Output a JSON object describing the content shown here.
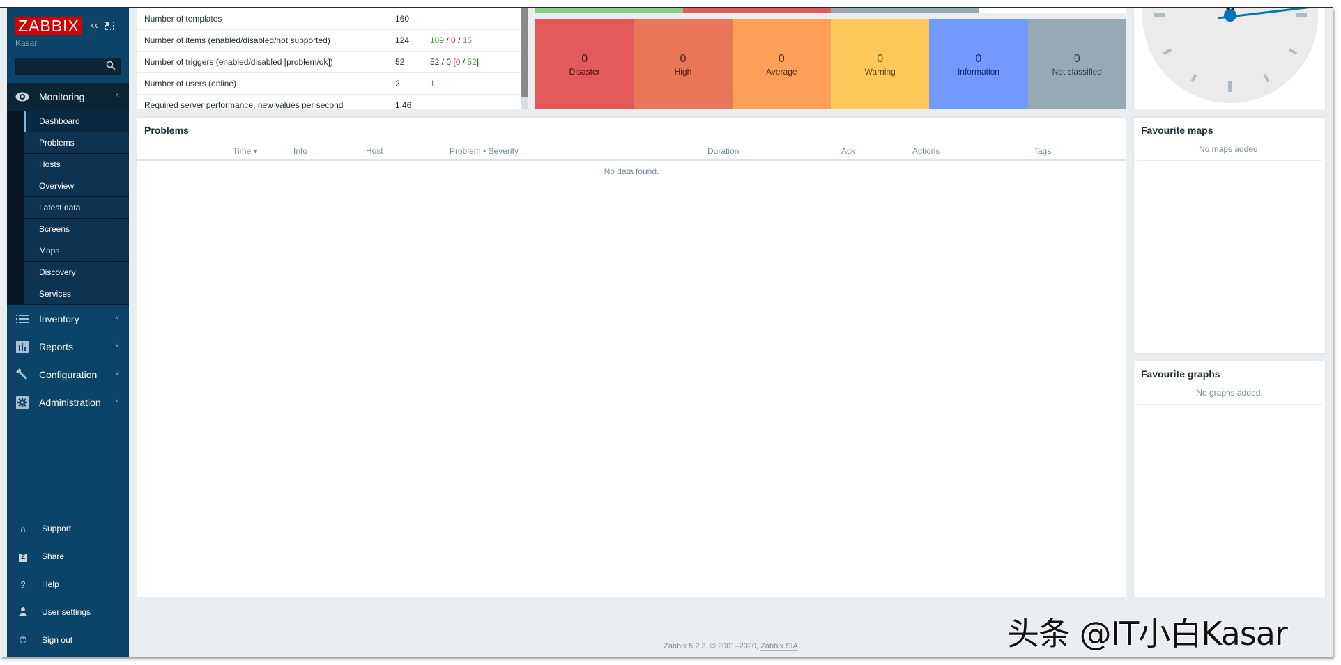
{
  "sidebar": {
    "logo": "ZABBIX",
    "username": "Kasar",
    "search": {
      "value": "",
      "placeholder": ""
    },
    "menu": [
      {
        "label": "Monitoring",
        "icon": "eye-icon",
        "expanded": true,
        "children": [
          "Dashboard",
          "Problems",
          "Hosts",
          "Overview",
          "Latest data",
          "Screens",
          "Maps",
          "Discovery",
          "Services"
        ],
        "active_child": "Dashboard"
      },
      {
        "label": "Inventory",
        "icon": "list-icon",
        "expanded": false
      },
      {
        "label": "Reports",
        "icon": "bar-chart-icon",
        "expanded": false
      },
      {
        "label": "Configuration",
        "icon": "wrench-icon",
        "expanded": false
      },
      {
        "label": "Administration",
        "icon": "gear-icon",
        "expanded": false
      }
    ],
    "user_menu": [
      {
        "label": "Support",
        "icon": "headset-icon"
      },
      {
        "label": "Share",
        "icon": "share-z-icon"
      },
      {
        "label": "Help",
        "icon": "help-icon"
      },
      {
        "label": "User settings",
        "icon": "user-icon"
      },
      {
        "label": "Sign out",
        "icon": "power-icon"
      }
    ]
  },
  "stats": {
    "rows": [
      {
        "label": "Number of templates",
        "value": "160",
        "detail": []
      },
      {
        "label": "Number of items (enabled/disabled/not supported)",
        "value": "124",
        "detail": [
          {
            "t": "109",
            "c": "green"
          },
          {
            "t": " / ",
            "c": ""
          },
          {
            "t": "0",
            "c": "red"
          },
          {
            "t": " / ",
            "c": ""
          },
          {
            "t": "15",
            "c": "grey"
          }
        ]
      },
      {
        "label": "Number of triggers (enabled/disabled [problem/ok])",
        "value": "52",
        "detail": [
          {
            "t": "52 / 0 [",
            "c": ""
          },
          {
            "t": "0",
            "c": "red"
          },
          {
            "t": " / ",
            "c": ""
          },
          {
            "t": "52",
            "c": "green"
          },
          {
            "t": "]",
            "c": ""
          }
        ]
      },
      {
        "label": "Number of users (online)",
        "value": "2",
        "detail": [
          {
            "t": "1",
            "c": "green"
          }
        ]
      },
      {
        "label": "Required server performance, new values per second",
        "value": "1.46",
        "detail": []
      }
    ]
  },
  "host_availability_bar": [
    {
      "status": "available",
      "color": "#86cc89",
      "share": 0.25
    },
    {
      "status": "not available",
      "color": "#e45959",
      "share": 0.25
    },
    {
      "status": "unknown",
      "color": "#97aab3",
      "share": 0.25
    }
  ],
  "severity": [
    {
      "label": "Disaster",
      "count": "0",
      "bg": "#e45959",
      "fg": "#4c0a0a"
    },
    {
      "label": "High",
      "count": "0",
      "bg": "#e97659",
      "fg": "#4f1c0d"
    },
    {
      "label": "Average",
      "count": "0",
      "bg": "#ffa059",
      "fg": "#5c2d0c"
    },
    {
      "label": "Warning",
      "count": "0",
      "bg": "#ffc859",
      "fg": "#604a0d"
    },
    {
      "label": "Information",
      "count": "0",
      "bg": "#7499ff",
      "fg": "#0e2a78"
    },
    {
      "label": "Not classified",
      "count": "0",
      "bg": "#97aab3",
      "fg": "#2a3a42"
    }
  ],
  "problems": {
    "title": "Problems",
    "columns": [
      "Time ▾",
      "Info",
      "Host",
      "Problem • Severity",
      "Duration",
      "Ack",
      "Actions",
      "Tags"
    ],
    "empty_text": "No data found."
  },
  "fav_maps": {
    "title": "Favourite maps",
    "empty_text": "No maps added."
  },
  "fav_graphs": {
    "title": "Favourite graphs",
    "empty_text": "No graphs added."
  },
  "footer": {
    "text": "Zabbix 5.2.3. © 2001–2020, ",
    "link": "Zabbix SIA"
  },
  "watermark": "头条 @IT小白Kasar"
}
